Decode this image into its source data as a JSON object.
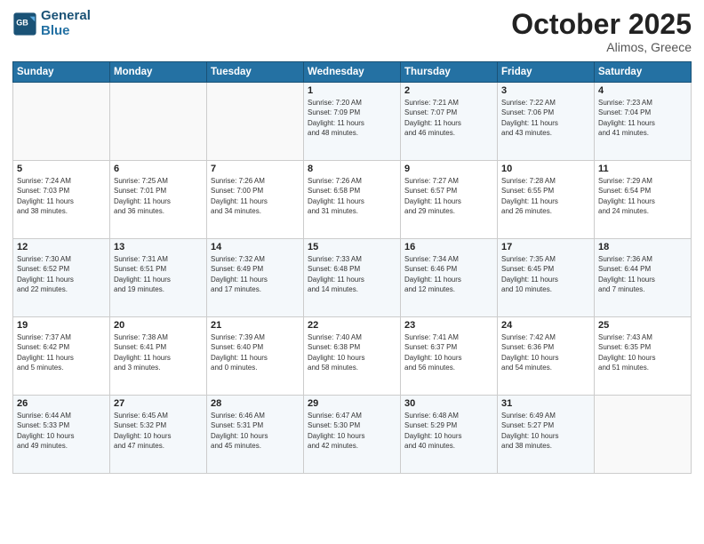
{
  "header": {
    "logo_line1": "General",
    "logo_line2": "Blue",
    "month_title": "October 2025",
    "subtitle": "Alimos, Greece"
  },
  "weekdays": [
    "Sunday",
    "Monday",
    "Tuesday",
    "Wednesday",
    "Thursday",
    "Friday",
    "Saturday"
  ],
  "weeks": [
    [
      {
        "day": "",
        "info": ""
      },
      {
        "day": "",
        "info": ""
      },
      {
        "day": "",
        "info": ""
      },
      {
        "day": "1",
        "info": "Sunrise: 7:20 AM\nSunset: 7:09 PM\nDaylight: 11 hours\nand 48 minutes."
      },
      {
        "day": "2",
        "info": "Sunrise: 7:21 AM\nSunset: 7:07 PM\nDaylight: 11 hours\nand 46 minutes."
      },
      {
        "day": "3",
        "info": "Sunrise: 7:22 AM\nSunset: 7:06 PM\nDaylight: 11 hours\nand 43 minutes."
      },
      {
        "day": "4",
        "info": "Sunrise: 7:23 AM\nSunset: 7:04 PM\nDaylight: 11 hours\nand 41 minutes."
      }
    ],
    [
      {
        "day": "5",
        "info": "Sunrise: 7:24 AM\nSunset: 7:03 PM\nDaylight: 11 hours\nand 38 minutes."
      },
      {
        "day": "6",
        "info": "Sunrise: 7:25 AM\nSunset: 7:01 PM\nDaylight: 11 hours\nand 36 minutes."
      },
      {
        "day": "7",
        "info": "Sunrise: 7:26 AM\nSunset: 7:00 PM\nDaylight: 11 hours\nand 34 minutes."
      },
      {
        "day": "8",
        "info": "Sunrise: 7:26 AM\nSunset: 6:58 PM\nDaylight: 11 hours\nand 31 minutes."
      },
      {
        "day": "9",
        "info": "Sunrise: 7:27 AM\nSunset: 6:57 PM\nDaylight: 11 hours\nand 29 minutes."
      },
      {
        "day": "10",
        "info": "Sunrise: 7:28 AM\nSunset: 6:55 PM\nDaylight: 11 hours\nand 26 minutes."
      },
      {
        "day": "11",
        "info": "Sunrise: 7:29 AM\nSunset: 6:54 PM\nDaylight: 11 hours\nand 24 minutes."
      }
    ],
    [
      {
        "day": "12",
        "info": "Sunrise: 7:30 AM\nSunset: 6:52 PM\nDaylight: 11 hours\nand 22 minutes."
      },
      {
        "day": "13",
        "info": "Sunrise: 7:31 AM\nSunset: 6:51 PM\nDaylight: 11 hours\nand 19 minutes."
      },
      {
        "day": "14",
        "info": "Sunrise: 7:32 AM\nSunset: 6:49 PM\nDaylight: 11 hours\nand 17 minutes."
      },
      {
        "day": "15",
        "info": "Sunrise: 7:33 AM\nSunset: 6:48 PM\nDaylight: 11 hours\nand 14 minutes."
      },
      {
        "day": "16",
        "info": "Sunrise: 7:34 AM\nSunset: 6:46 PM\nDaylight: 11 hours\nand 12 minutes."
      },
      {
        "day": "17",
        "info": "Sunrise: 7:35 AM\nSunset: 6:45 PM\nDaylight: 11 hours\nand 10 minutes."
      },
      {
        "day": "18",
        "info": "Sunrise: 7:36 AM\nSunset: 6:44 PM\nDaylight: 11 hours\nand 7 minutes."
      }
    ],
    [
      {
        "day": "19",
        "info": "Sunrise: 7:37 AM\nSunset: 6:42 PM\nDaylight: 11 hours\nand 5 minutes."
      },
      {
        "day": "20",
        "info": "Sunrise: 7:38 AM\nSunset: 6:41 PM\nDaylight: 11 hours\nand 3 minutes."
      },
      {
        "day": "21",
        "info": "Sunrise: 7:39 AM\nSunset: 6:40 PM\nDaylight: 11 hours\nand 0 minutes."
      },
      {
        "day": "22",
        "info": "Sunrise: 7:40 AM\nSunset: 6:38 PM\nDaylight: 10 hours\nand 58 minutes."
      },
      {
        "day": "23",
        "info": "Sunrise: 7:41 AM\nSunset: 6:37 PM\nDaylight: 10 hours\nand 56 minutes."
      },
      {
        "day": "24",
        "info": "Sunrise: 7:42 AM\nSunset: 6:36 PM\nDaylight: 10 hours\nand 54 minutes."
      },
      {
        "day": "25",
        "info": "Sunrise: 7:43 AM\nSunset: 6:35 PM\nDaylight: 10 hours\nand 51 minutes."
      }
    ],
    [
      {
        "day": "26",
        "info": "Sunrise: 6:44 AM\nSunset: 5:33 PM\nDaylight: 10 hours\nand 49 minutes."
      },
      {
        "day": "27",
        "info": "Sunrise: 6:45 AM\nSunset: 5:32 PM\nDaylight: 10 hours\nand 47 minutes."
      },
      {
        "day": "28",
        "info": "Sunrise: 6:46 AM\nSunset: 5:31 PM\nDaylight: 10 hours\nand 45 minutes."
      },
      {
        "day": "29",
        "info": "Sunrise: 6:47 AM\nSunset: 5:30 PM\nDaylight: 10 hours\nand 42 minutes."
      },
      {
        "day": "30",
        "info": "Sunrise: 6:48 AM\nSunset: 5:29 PM\nDaylight: 10 hours\nand 40 minutes."
      },
      {
        "day": "31",
        "info": "Sunrise: 6:49 AM\nSunset: 5:27 PM\nDaylight: 10 hours\nand 38 minutes."
      },
      {
        "day": "",
        "info": ""
      }
    ]
  ]
}
